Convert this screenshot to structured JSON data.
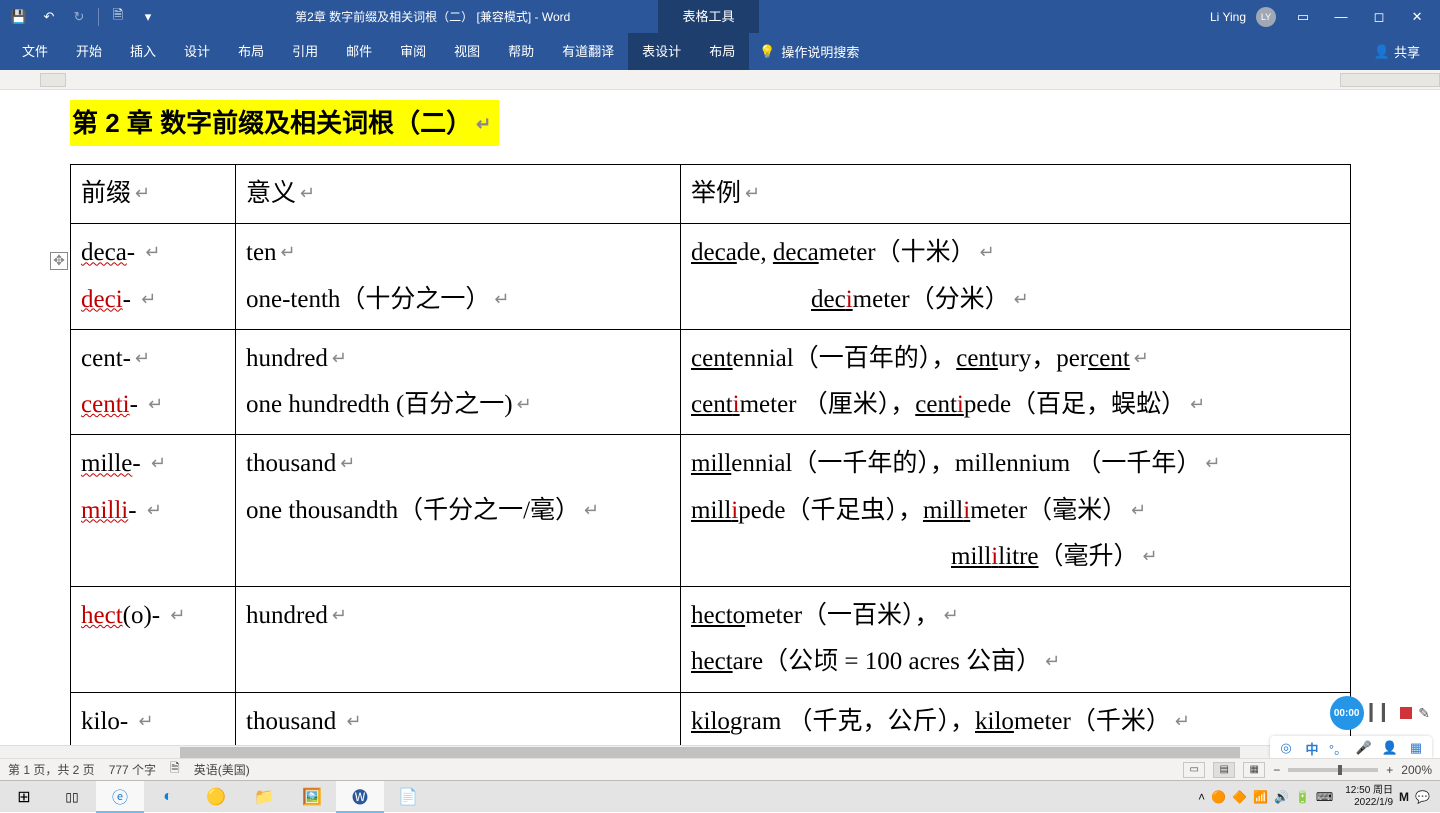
{
  "titlebar": {
    "doc_title": "第2章 数字前缀及相关词根（二）  [兼容模式]  -  Word",
    "tabletools": "表格工具",
    "user_name": "Li Ying",
    "user_initials": "LY"
  },
  "ribbon": {
    "tabs": [
      "文件",
      "开始",
      "插入",
      "设计",
      "布局",
      "引用",
      "邮件",
      "审阅",
      "视图",
      "帮助",
      "有道翻译",
      "表设计",
      "布局"
    ],
    "tellme": "操作说明搜索",
    "share": "共享"
  },
  "doc": {
    "heading": "第 2 章  数字前缀及相关词根（二）",
    "headers": {
      "prefix": "前缀",
      "meaning": "意义",
      "example": "举例"
    },
    "rows": [
      {
        "prefix_lines": [
          {
            "segs": [
              {
                "t": "deca",
                "u": true,
                "wavy": true
              },
              {
                "t": "- "
              }
            ]
          },
          {
            "segs": [
              {
                "t": "deci",
                "red": true,
                "u": true,
                "wavy": true
              },
              {
                "t": "- "
              }
            ]
          }
        ],
        "meaning_lines": [
          {
            "segs": [
              {
                "t": "ten"
              }
            ]
          },
          {
            "segs": [
              {
                "t": "one-tenth（十分之一）"
              }
            ]
          }
        ],
        "example_lines": [
          {
            "segs": [
              {
                "t": "deca",
                "u": true
              },
              {
                "t": "de,   "
              },
              {
                "t": "deca",
                "u": true
              },
              {
                "t": "meter（十米）"
              }
            ]
          },
          {
            "indent": "indent1",
            "segs": [
              {
                "t": "dec",
                "u": true
              },
              {
                "t": "i",
                "u": true,
                "red": true
              },
              {
                "t": "meter（分米）"
              }
            ]
          }
        ]
      },
      {
        "prefix_lines": [
          {
            "segs": [
              {
                "t": "cent-"
              }
            ]
          },
          {
            "segs": [
              {
                "t": "centi",
                "red": true,
                "u": true,
                "wavy": true
              },
              {
                "t": "- "
              }
            ]
          }
        ],
        "meaning_lines": [
          {
            "segs": [
              {
                "t": "hundred"
              }
            ]
          },
          {
            "segs": [
              {
                "t": "one hundredth (百分之一)"
              }
            ]
          }
        ],
        "example_lines": [
          {
            "segs": [
              {
                "t": "cent",
                "u": true
              },
              {
                "t": "ennial（一百年的），"
              },
              {
                "t": "cent",
                "u": true
              },
              {
                "t": "ury，per"
              },
              {
                "t": "cent",
                "u": true
              }
            ]
          },
          {
            "segs": [
              {
                "t": "cent",
                "u": true
              },
              {
                "t": "i",
                "u": true,
                "red": true
              },
              {
                "t": "meter  （厘米），"
              },
              {
                "t": "cent",
                "u": true
              },
              {
                "t": "i",
                "u": true,
                "red": true
              },
              {
                "t": "pede（百足，蜈蚣）"
              }
            ]
          }
        ]
      },
      {
        "prefix_lines": [
          {
            "segs": [
              {
                "t": "mille",
                "u": true,
                "wavy": true
              },
              {
                "t": "- "
              }
            ]
          },
          {
            "segs": [
              {
                "t": "milli",
                "red": true,
                "u": true,
                "wavy": true
              },
              {
                "t": "- "
              }
            ]
          }
        ],
        "meaning_lines": [
          {
            "segs": [
              {
                "t": "thousand"
              }
            ]
          },
          {
            "segs": [
              {
                "t": "one thousandth（千分之一/毫）"
              }
            ]
          }
        ],
        "example_lines": [
          {
            "segs": [
              {
                "t": "mill",
                "u": true
              },
              {
                "t": "ennial（一千年的），millennium （一千年）"
              }
            ]
          },
          {
            "segs": [
              {
                "t": "mill",
                "u": true
              },
              {
                "t": "i",
                "u": true,
                "red": true
              },
              {
                "t": "pede（千足虫），"
              },
              {
                "t": "mill",
                "u": true
              },
              {
                "t": "i",
                "u": true,
                "red": true
              },
              {
                "t": "meter（毫米）"
              }
            ]
          },
          {
            "indent": "indent2",
            "segs": [
              {
                "t": "mill",
                "u": true
              },
              {
                "t": "i",
                "u": true,
                "red": true
              },
              {
                "t": "litre",
                "u": true
              },
              {
                "t": "（毫升）"
              }
            ]
          }
        ]
      },
      {
        "prefix_lines": [
          {
            "segs": [
              {
                "t": "hect",
                "red": true,
                "u": true,
                "wavy": true
              },
              {
                "t": "(o)- "
              }
            ]
          }
        ],
        "meaning_lines": [
          {
            "segs": [
              {
                "t": "hundred"
              }
            ]
          }
        ],
        "example_lines": [
          {
            "segs": [
              {
                "t": "hecto",
                "u": true
              },
              {
                "t": "meter（一百米），"
              }
            ]
          },
          {
            "segs": [
              {
                "t": "hect",
                "u": true
              },
              {
                "t": "are（公顷  = 100 acres 公亩）"
              }
            ]
          }
        ]
      },
      {
        "prefix_lines": [
          {
            "segs": [
              {
                "t": "kilo- "
              }
            ]
          }
        ],
        "meaning_lines": [
          {
            "segs": [
              {
                "t": "thousand "
              }
            ]
          }
        ],
        "example_lines": [
          {
            "segs": [
              {
                "t": "kilo",
                "u": true
              },
              {
                "t": "gram  （千克，公斤），"
              },
              {
                "t": "kilo",
                "u": true
              },
              {
                "t": "meter（千米）"
              }
            ]
          }
        ]
      }
    ]
  },
  "status": {
    "page": "第 1 页，共 2 页",
    "words": "777 个字",
    "lang": "英语(美国)",
    "zoom": "200%"
  },
  "rec": {
    "time": "00:00"
  },
  "ime": {
    "lang": "中"
  },
  "taskbar": {
    "time": "12:50",
    "day": "周日",
    "date": "2022/1/9"
  }
}
